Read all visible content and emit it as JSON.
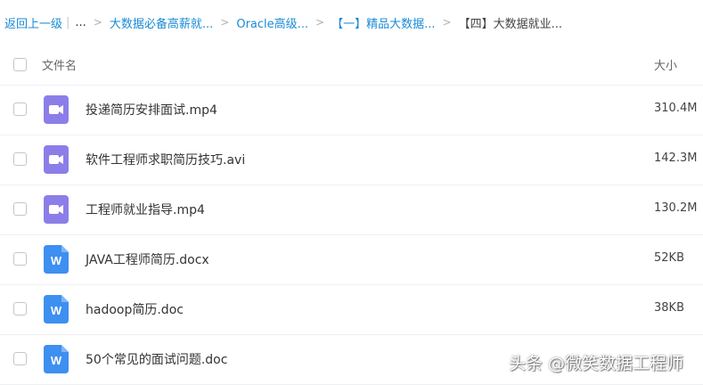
{
  "breadcrumb": {
    "back": "返回上一级",
    "ellipsis": "...",
    "items": [
      "大数据必备高薪就...",
      "Oracle高级...",
      "【一】精品大数据...",
      "【四】大数据就业..."
    ]
  },
  "header": {
    "name_label": "文件名",
    "size_label": "大小"
  },
  "files": [
    {
      "name": "投递简历安排面试.mp4",
      "size": "310.4M",
      "type": "video-icon"
    },
    {
      "name": "软件工程师求职简历技巧.avi",
      "size": "142.3M",
      "type": "video-icon"
    },
    {
      "name": "工程师就业指导.mp4",
      "size": "130.2M",
      "type": "video-icon"
    },
    {
      "name": "JAVA工程师简历.docx",
      "size": "52KB",
      "type": "word-doc-icon"
    },
    {
      "name": "hadoop简历.doc",
      "size": "38KB",
      "type": "word-doc-icon"
    },
    {
      "name": "50个常见的面试问题.doc",
      "size": "",
      "type": "word-doc-icon"
    }
  ],
  "watermark": "头条 @微笑数据工程师",
  "colors": {
    "link": "#1a8bd6",
    "video": "#8c7ee8",
    "word": "#3d8ff0"
  }
}
